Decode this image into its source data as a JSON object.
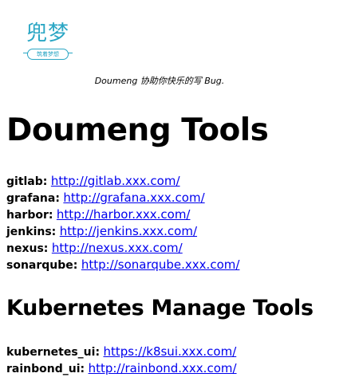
{
  "logo": {
    "title": "兜梦",
    "subtitle": "筑着梦想"
  },
  "tagline": "Doumeng 协助你快乐的写 Bug.",
  "heading_tools": "Doumeng Tools",
  "tools": [
    {
      "name": "gitlab:",
      "url": "http://gitlab.xxx.com/"
    },
    {
      "name": "grafana:",
      "url": "http://grafana.xxx.com/"
    },
    {
      "name": "harbor:",
      "url": "http://harbor.xxx.com/"
    },
    {
      "name": "jenkins:",
      "url": "http://jenkins.xxx.com/"
    },
    {
      "name": "nexus:",
      "url": "http://nexus.xxx.com/"
    },
    {
      "name": "sonarqube:",
      "url": "http://sonarqube.xxx.com/"
    }
  ],
  "heading_k8s": "Kubernetes Manage Tools",
  "k8s_tools": [
    {
      "name": "kubernetes_ui:",
      "url": "https://k8sui.xxx.com/"
    },
    {
      "name": "rainbond_ui:",
      "url": "http://rainbond.xxx.com/"
    }
  ],
  "colors": {
    "logo": "#2aa6c4",
    "link": "#0000ee",
    "text": "#000000",
    "background": "#ffffff"
  }
}
